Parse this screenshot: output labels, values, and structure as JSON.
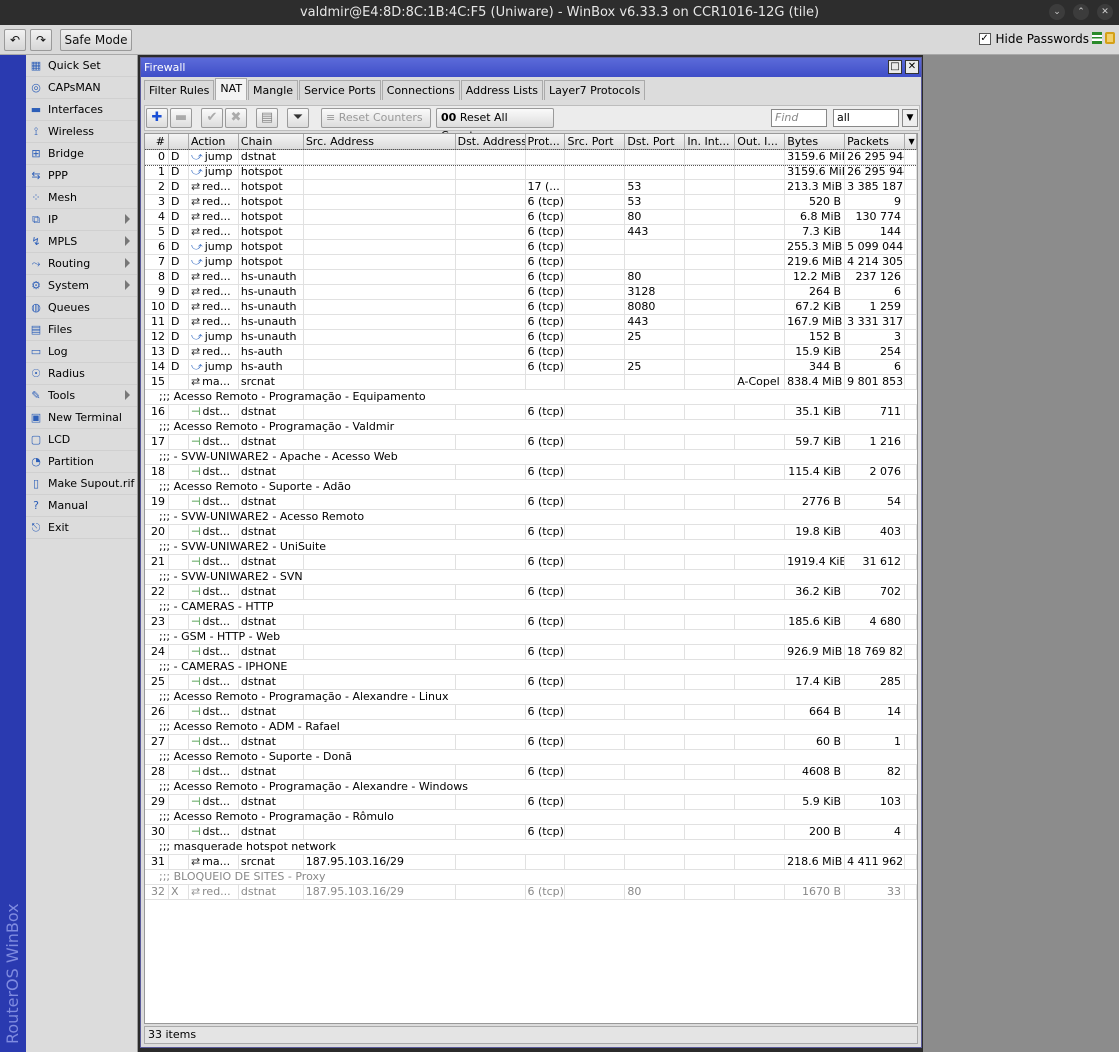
{
  "titlebar": {
    "title": "valdmir@E4:8D:8C:1B:4C:F5 (Uniware) - WinBox v6.33.3 on CCR1016-12G (tile)"
  },
  "toolbar": {
    "undo": "↶",
    "redo": "↷",
    "safe_mode": "Safe Mode",
    "hide_passwords": "Hide Passwords",
    "hide_passwords_checked": true
  },
  "brand_vertical": "RouterOS WinBox",
  "sidebar": {
    "items": [
      {
        "label": "Quick Set",
        "icon": "quick-set-icon",
        "sub": false
      },
      {
        "label": "CAPsMAN",
        "icon": "capsman-icon",
        "sub": false
      },
      {
        "label": "Interfaces",
        "icon": "interfaces-icon",
        "sub": false
      },
      {
        "label": "Wireless",
        "icon": "wireless-icon",
        "sub": false
      },
      {
        "label": "Bridge",
        "icon": "bridge-icon",
        "sub": false
      },
      {
        "label": "PPP",
        "icon": "ppp-icon",
        "sub": false
      },
      {
        "label": "Mesh",
        "icon": "mesh-icon",
        "sub": false
      },
      {
        "label": "IP",
        "icon": "ip-icon",
        "sub": true
      },
      {
        "label": "MPLS",
        "icon": "mpls-icon",
        "sub": true
      },
      {
        "label": "Routing",
        "icon": "routing-icon",
        "sub": true
      },
      {
        "label": "System",
        "icon": "system-icon",
        "sub": true
      },
      {
        "label": "Queues",
        "icon": "queues-icon",
        "sub": false
      },
      {
        "label": "Files",
        "icon": "files-icon",
        "sub": false
      },
      {
        "label": "Log",
        "icon": "log-icon",
        "sub": false
      },
      {
        "label": "Radius",
        "icon": "radius-icon",
        "sub": false
      },
      {
        "label": "Tools",
        "icon": "tools-icon",
        "sub": true
      },
      {
        "label": "New Terminal",
        "icon": "terminal-icon",
        "sub": false
      },
      {
        "label": "LCD",
        "icon": "lcd-icon",
        "sub": false
      },
      {
        "label": "Partition",
        "icon": "partition-icon",
        "sub": false
      },
      {
        "label": "Make Supout.rif",
        "icon": "supout-icon",
        "sub": false
      },
      {
        "label": "Manual",
        "icon": "manual-icon",
        "sub": false
      },
      {
        "label": "Exit",
        "icon": "exit-icon",
        "sub": false
      }
    ]
  },
  "window": {
    "title": "Firewall",
    "restore": "□",
    "close": "✕"
  },
  "tabs": [
    {
      "label": "Filter Rules",
      "active": false
    },
    {
      "label": "NAT",
      "active": true
    },
    {
      "label": "Mangle",
      "active": false
    },
    {
      "label": "Service Ports",
      "active": false
    },
    {
      "label": "Connections",
      "active": false
    },
    {
      "label": "Address Lists",
      "active": false
    },
    {
      "label": "Layer7 Protocols",
      "active": false
    }
  ],
  "rule_toolbar": {
    "reset_counters": "Reset Counters",
    "reset_all_counters": "Reset All Counters",
    "reset_all_prefix": "00",
    "find_placeholder": "Find",
    "filter_value": "all"
  },
  "columns": [
    "#",
    "",
    "Action",
    "Chain",
    "Src. Address",
    "Dst. Address",
    "Prot...",
    "Src. Port",
    "Dst. Port",
    "In. Int...",
    "Out. I...",
    "Bytes",
    "Packets"
  ],
  "rows": [
    {
      "t": "r",
      "n": "0",
      "f": "D",
      "a": "jump",
      "ai": "jump",
      "c": "dstnat",
      "src": "",
      "dst": "",
      "p": "",
      "sp": "",
      "dp": "",
      "in": "",
      "out": "",
      "b": "3159.6 MiB",
      "pk": "26 295 944"
    },
    {
      "t": "r",
      "n": "1",
      "f": "D",
      "a": "jump",
      "ai": "jump",
      "c": "hotspot",
      "src": "",
      "dst": "",
      "p": "",
      "sp": "",
      "dp": "",
      "in": "",
      "out": "",
      "b": "3159.6 MiB",
      "pk": "26 295 944"
    },
    {
      "t": "r",
      "n": "2",
      "f": "D",
      "a": "red...",
      "ai": "red",
      "c": "hotspot",
      "src": "",
      "dst": "",
      "p": "17 (...",
      "sp": "",
      "dp": "53",
      "in": "",
      "out": "",
      "b": "213.3 MiB",
      "pk": "3 385 187"
    },
    {
      "t": "r",
      "n": "3",
      "f": "D",
      "a": "red...",
      "ai": "red",
      "c": "hotspot",
      "src": "",
      "dst": "",
      "p": "6 (tcp)",
      "sp": "",
      "dp": "53",
      "in": "",
      "out": "",
      "b": "520 B",
      "pk": "9"
    },
    {
      "t": "r",
      "n": "4",
      "f": "D",
      "a": "red...",
      "ai": "red",
      "c": "hotspot",
      "src": "",
      "dst": "",
      "p": "6 (tcp)",
      "sp": "",
      "dp": "80",
      "in": "",
      "out": "",
      "b": "6.8 MiB",
      "pk": "130 774"
    },
    {
      "t": "r",
      "n": "5",
      "f": "D",
      "a": "red...",
      "ai": "red",
      "c": "hotspot",
      "src": "",
      "dst": "",
      "p": "6 (tcp)",
      "sp": "",
      "dp": "443",
      "in": "",
      "out": "",
      "b": "7.3 KiB",
      "pk": "144"
    },
    {
      "t": "r",
      "n": "6",
      "f": "D",
      "a": "jump",
      "ai": "jump",
      "c": "hotspot",
      "src": "",
      "dst": "",
      "p": "6 (tcp)",
      "sp": "",
      "dp": "",
      "in": "",
      "out": "",
      "b": "255.3 MiB",
      "pk": "5 099 044"
    },
    {
      "t": "r",
      "n": "7",
      "f": "D",
      "a": "jump",
      "ai": "jump",
      "c": "hotspot",
      "src": "",
      "dst": "",
      "p": "6 (tcp)",
      "sp": "",
      "dp": "",
      "in": "",
      "out": "",
      "b": "219.6 MiB",
      "pk": "4 214 305"
    },
    {
      "t": "r",
      "n": "8",
      "f": "D",
      "a": "red...",
      "ai": "red",
      "c": "hs-unauth",
      "src": "",
      "dst": "",
      "p": "6 (tcp)",
      "sp": "",
      "dp": "80",
      "in": "",
      "out": "",
      "b": "12.2 MiB",
      "pk": "237 126"
    },
    {
      "t": "r",
      "n": "9",
      "f": "D",
      "a": "red...",
      "ai": "red",
      "c": "hs-unauth",
      "src": "",
      "dst": "",
      "p": "6 (tcp)",
      "sp": "",
      "dp": "3128",
      "in": "",
      "out": "",
      "b": "264 B",
      "pk": "6"
    },
    {
      "t": "r",
      "n": "10",
      "f": "D",
      "a": "red...",
      "ai": "red",
      "c": "hs-unauth",
      "src": "",
      "dst": "",
      "p": "6 (tcp)",
      "sp": "",
      "dp": "8080",
      "in": "",
      "out": "",
      "b": "67.2 KiB",
      "pk": "1 259"
    },
    {
      "t": "r",
      "n": "11",
      "f": "D",
      "a": "red...",
      "ai": "red",
      "c": "hs-unauth",
      "src": "",
      "dst": "",
      "p": "6 (tcp)",
      "sp": "",
      "dp": "443",
      "in": "",
      "out": "",
      "b": "167.9 MiB",
      "pk": "3 331 317"
    },
    {
      "t": "r",
      "n": "12",
      "f": "D",
      "a": "jump",
      "ai": "jump",
      "c": "hs-unauth",
      "src": "",
      "dst": "",
      "p": "6 (tcp)",
      "sp": "",
      "dp": "25",
      "in": "",
      "out": "",
      "b": "152 B",
      "pk": "3"
    },
    {
      "t": "r",
      "n": "13",
      "f": "D",
      "a": "red...",
      "ai": "red",
      "c": "hs-auth",
      "src": "",
      "dst": "",
      "p": "6 (tcp)",
      "sp": "",
      "dp": "",
      "in": "",
      "out": "",
      "b": "15.9 KiB",
      "pk": "254"
    },
    {
      "t": "r",
      "n": "14",
      "f": "D",
      "a": "jump",
      "ai": "jump",
      "c": "hs-auth",
      "src": "",
      "dst": "",
      "p": "6 (tcp)",
      "sp": "",
      "dp": "25",
      "in": "",
      "out": "",
      "b": "344 B",
      "pk": "6"
    },
    {
      "t": "r",
      "n": "15",
      "f": "",
      "a": "ma...",
      "ai": "masq",
      "c": "srcnat",
      "src": "",
      "dst": "",
      "p": "",
      "sp": "",
      "dp": "",
      "in": "",
      "out": "A-Copel",
      "b": "838.4 MiB",
      "pk": "9 801 853"
    },
    {
      "t": "c",
      "text": ";;; Acesso Remoto - Programação - Equipamento"
    },
    {
      "t": "r",
      "n": "16",
      "f": "",
      "a": "dst...",
      "ai": "dst",
      "c": "dstnat",
      "src": "",
      "dst": "",
      "p": "6 (tcp)",
      "sp": "",
      "dp": "",
      "in": "",
      "out": "",
      "b": "35.1 KiB",
      "pk": "711"
    },
    {
      "t": "c",
      "text": ";;; Acesso Remoto - Programação - Valdmir"
    },
    {
      "t": "r",
      "n": "17",
      "f": "",
      "a": "dst...",
      "ai": "dst",
      "c": "dstnat",
      "src": "",
      "dst": "",
      "p": "6 (tcp)",
      "sp": "",
      "dp": "",
      "in": "",
      "out": "",
      "b": "59.7 KiB",
      "pk": "1 216"
    },
    {
      "t": "c",
      "text": ";;; - SVW-UNIWARE2 - Apache - Acesso Web"
    },
    {
      "t": "r",
      "n": "18",
      "f": "",
      "a": "dst...",
      "ai": "dst",
      "c": "dstnat",
      "src": "",
      "dst": "",
      "p": "6 (tcp)",
      "sp": "",
      "dp": "",
      "in": "",
      "out": "",
      "b": "115.4 KiB",
      "pk": "2 076"
    },
    {
      "t": "c",
      "text": ";;; Acesso Remoto - Suporte - Adão"
    },
    {
      "t": "r",
      "n": "19",
      "f": "",
      "a": "dst...",
      "ai": "dst",
      "c": "dstnat",
      "src": "",
      "dst": "",
      "p": "6 (tcp)",
      "sp": "",
      "dp": "",
      "in": "",
      "out": "",
      "b": "2776 B",
      "pk": "54"
    },
    {
      "t": "c",
      "text": ";;; - SVW-UNIWARE2 - Acesso Remoto"
    },
    {
      "t": "r",
      "n": "20",
      "f": "",
      "a": "dst...",
      "ai": "dst",
      "c": "dstnat",
      "src": "",
      "dst": "",
      "p": "6 (tcp)",
      "sp": "",
      "dp": "",
      "in": "",
      "out": "",
      "b": "19.8 KiB",
      "pk": "403"
    },
    {
      "t": "c",
      "text": ";;; - SVW-UNIWARE2 - UniSuite"
    },
    {
      "t": "r",
      "n": "21",
      "f": "",
      "a": "dst...",
      "ai": "dst",
      "c": "dstnat",
      "src": "",
      "dst": "",
      "p": "6 (tcp)",
      "sp": "",
      "dp": "",
      "in": "",
      "out": "",
      "b": "1919.4 KiB",
      "pk": "31 612"
    },
    {
      "t": "c",
      "text": ";;; - SVW-UNIWARE2 - SVN"
    },
    {
      "t": "r",
      "n": "22",
      "f": "",
      "a": "dst...",
      "ai": "dst",
      "c": "dstnat",
      "src": "",
      "dst": "",
      "p": "6 (tcp)",
      "sp": "",
      "dp": "",
      "in": "",
      "out": "",
      "b": "36.2 KiB",
      "pk": "702"
    },
    {
      "t": "c",
      "text": ";;; - CAMERAS - HTTP"
    },
    {
      "t": "r",
      "n": "23",
      "f": "",
      "a": "dst...",
      "ai": "dst",
      "c": "dstnat",
      "src": "",
      "dst": "",
      "p": "6 (tcp)",
      "sp": "",
      "dp": "",
      "in": "",
      "out": "",
      "b": "185.6 KiB",
      "pk": "4 680"
    },
    {
      "t": "c",
      "text": ";;; - GSM - HTTP - Web"
    },
    {
      "t": "r",
      "n": "24",
      "f": "",
      "a": "dst...",
      "ai": "dst",
      "c": "dstnat",
      "src": "",
      "dst": "",
      "p": "6 (tcp)",
      "sp": "",
      "dp": "",
      "in": "",
      "out": "",
      "b": "926.9 MiB",
      "pk": "18 769 827"
    },
    {
      "t": "c",
      "text": ";;; - CAMERAS - IPHONE"
    },
    {
      "t": "r",
      "n": "25",
      "f": "",
      "a": "dst...",
      "ai": "dst",
      "c": "dstnat",
      "src": "",
      "dst": "",
      "p": "6 (tcp)",
      "sp": "",
      "dp": "",
      "in": "",
      "out": "",
      "b": "17.4 KiB",
      "pk": "285"
    },
    {
      "t": "c",
      "text": ";;; Acesso Remoto - Programação - Alexandre - Linux"
    },
    {
      "t": "r",
      "n": "26",
      "f": "",
      "a": "dst...",
      "ai": "dst",
      "c": "dstnat",
      "src": "",
      "dst": "",
      "p": "6 (tcp)",
      "sp": "",
      "dp": "",
      "in": "",
      "out": "",
      "b": "664 B",
      "pk": "14"
    },
    {
      "t": "c",
      "text": ";;; Acesso Remoto - ADM - Rafael"
    },
    {
      "t": "r",
      "n": "27",
      "f": "",
      "a": "dst...",
      "ai": "dst",
      "c": "dstnat",
      "src": "",
      "dst": "",
      "p": "6 (tcp)",
      "sp": "",
      "dp": "",
      "in": "",
      "out": "",
      "b": "60 B",
      "pk": "1"
    },
    {
      "t": "c",
      "text": ";;; Acesso Remoto - Suporte - Donã"
    },
    {
      "t": "r",
      "n": "28",
      "f": "",
      "a": "dst...",
      "ai": "dst",
      "c": "dstnat",
      "src": "",
      "dst": "",
      "p": "6 (tcp)",
      "sp": "",
      "dp": "",
      "in": "",
      "out": "",
      "b": "4608 B",
      "pk": "82"
    },
    {
      "t": "c",
      "text": ";;; Acesso Remoto - Programação - Alexandre - Windows"
    },
    {
      "t": "r",
      "n": "29",
      "f": "",
      "a": "dst...",
      "ai": "dst",
      "c": "dstnat",
      "src": "",
      "dst": "",
      "p": "6 (tcp)",
      "sp": "",
      "dp": "",
      "in": "",
      "out": "",
      "b": "5.9 KiB",
      "pk": "103"
    },
    {
      "t": "c",
      "text": ";;; Acesso Remoto - Programação - Rômulo"
    },
    {
      "t": "r",
      "n": "30",
      "f": "",
      "a": "dst...",
      "ai": "dst",
      "c": "dstnat",
      "src": "",
      "dst": "",
      "p": "6 (tcp)",
      "sp": "",
      "dp": "",
      "in": "",
      "out": "",
      "b": "200 B",
      "pk": "4"
    },
    {
      "t": "c",
      "text": ";;; masquerade hotspot network"
    },
    {
      "t": "r",
      "n": "31",
      "f": "",
      "a": "ma...",
      "ai": "masq",
      "c": "srcnat",
      "src": "187.95.103.16/29",
      "dst": "",
      "p": "",
      "sp": "",
      "dp": "",
      "in": "",
      "out": "",
      "b": "218.6 MiB",
      "pk": "4 411 962"
    },
    {
      "t": "c",
      "text": ";;; BLOQUEIO DE SITES - Proxy",
      "disabled": true
    },
    {
      "t": "r",
      "n": "32",
      "f": "X",
      "a": "red...",
      "ai": "red",
      "c": "dstnat",
      "src": "187.95.103.16/29",
      "dst": "",
      "p": "6 (tcp)",
      "sp": "",
      "dp": "80",
      "in": "",
      "out": "",
      "b": "1670 B",
      "pk": "33",
      "disabled": true
    }
  ],
  "status": {
    "items_count": "33 items"
  },
  "colors": {
    "title_bar": "#2d2d2d",
    "window_title": "#4a58cf",
    "vertical_brand": "#2a3ab0",
    "jump_icon": "#3a6fc4",
    "action_icon": "#2a8a2a"
  }
}
